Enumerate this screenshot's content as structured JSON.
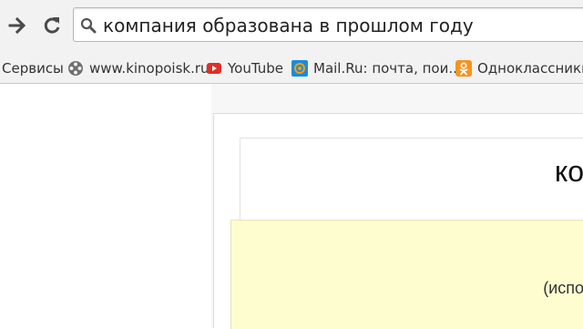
{
  "browser": {
    "omnibox": {
      "query": "компания образована в прошлом году"
    },
    "bookmarks": [
      {
        "label": "Сервисы",
        "icon": "none"
      },
      {
        "label": "www.kinopoisk.ru",
        "icon": "film-reel-icon"
      },
      {
        "label": "YouTube",
        "icon": "youtube-icon"
      },
      {
        "label": "Mail.Ru: почта, пои...",
        "icon": "mailru-icon"
      },
      {
        "label": "Одноклассники",
        "icon": "odnoklassniki-icon"
      }
    ],
    "colors": {
      "chrome_bg": "#f2f2f2",
      "youtube_red": "#e52d27",
      "mailru_blue": "#168de2",
      "mailru_orange": "#ff9e00",
      "ok_orange": "#f7931e",
      "highlight_yellow": "#fefdd0"
    }
  },
  "page": {
    "header_text": "ко",
    "yellow_text": "(испо"
  }
}
